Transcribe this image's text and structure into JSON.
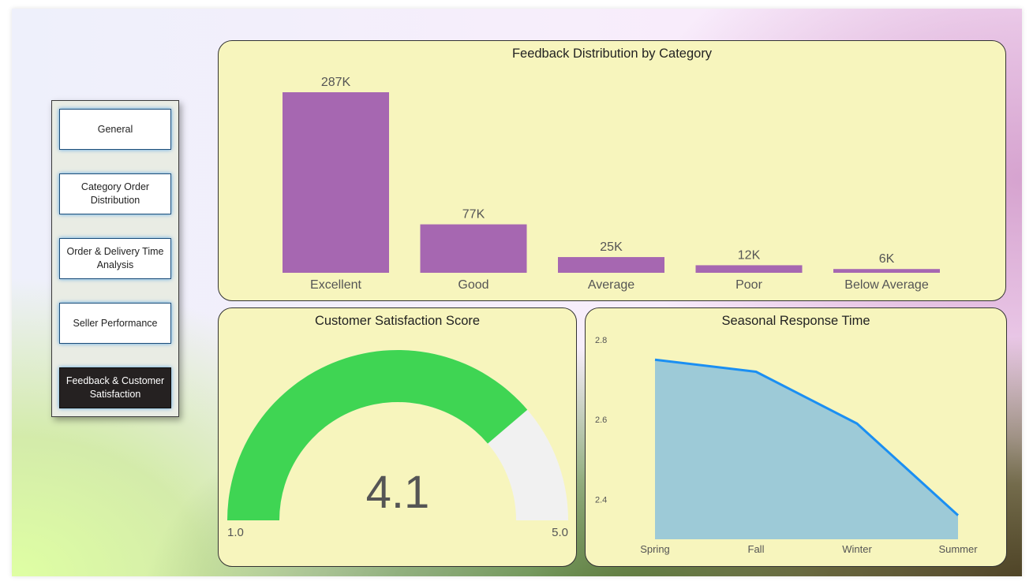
{
  "nav": {
    "items": [
      {
        "label": "General",
        "active": false
      },
      {
        "label": "Category Order Distribution",
        "active": false
      },
      {
        "label": "Order & Delivery Time Analysis",
        "active": false
      },
      {
        "label": "Seller Performance",
        "active": false
      },
      {
        "label": "Feedback & Customer Satisfaction",
        "active": true
      }
    ]
  },
  "colors": {
    "bar": "#a667b1",
    "gauge_fill": "#3fd553",
    "gauge_track": "#f1f1f1",
    "area_fill": "#9dcad7",
    "line": "#1b8ff2",
    "card_bg": "#f7f5bd",
    "nav_active_bg": "#252121"
  },
  "chart_data": [
    {
      "type": "bar",
      "title": "Feedback Distribution by Category",
      "categories": [
        "Excellent",
        "Good",
        "Average",
        "Poor",
        "Below Average"
      ],
      "values": [
        287,
        77,
        25,
        12,
        6
      ],
      "value_labels": [
        "287K",
        "77K",
        "25K",
        "12K",
        "6K"
      ],
      "unit": "K",
      "grid": false
    },
    {
      "type": "gauge",
      "title": "Customer Satisfaction Score",
      "value": 4.1,
      "value_label": "4.1",
      "min": 1.0,
      "max": 5.0,
      "min_label": "1.0",
      "max_label": "5.0"
    },
    {
      "type": "area",
      "title": "Seasonal Response Time",
      "categories": [
        "Spring",
        "Fall",
        "Winter",
        "Summer"
      ],
      "values": [
        2.75,
        2.72,
        2.59,
        2.36
      ],
      "ylim": [
        2.3,
        2.8
      ],
      "yticks": [
        2.4,
        2.6,
        2.8
      ],
      "ytick_labels": [
        "2.4",
        "2.6",
        "2.8"
      ],
      "grid": false
    }
  ]
}
